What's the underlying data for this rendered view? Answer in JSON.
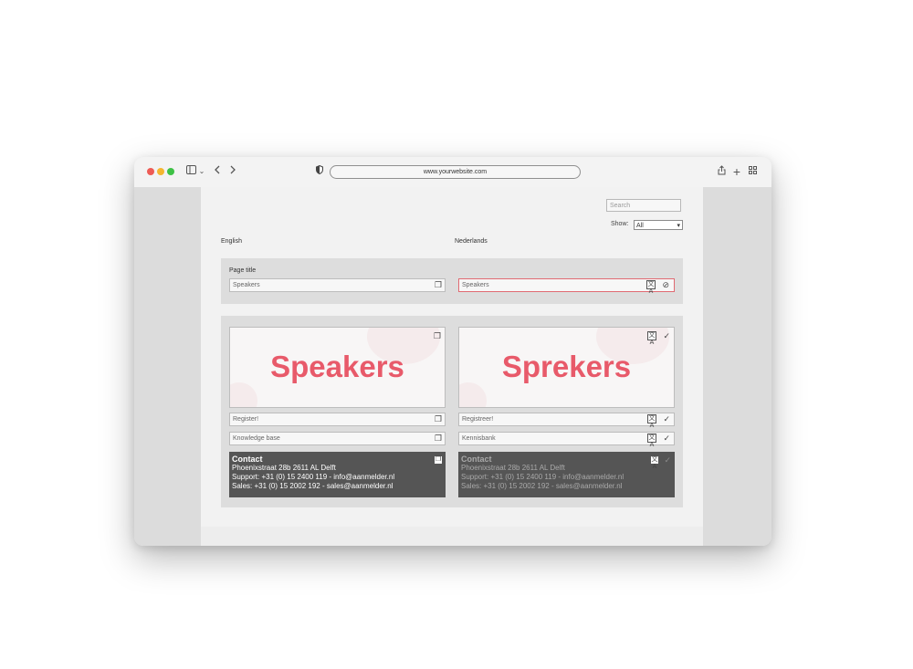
{
  "browser": {
    "url": "www.yourwebsite.com"
  },
  "page": {
    "search_placeholder": "Search",
    "show_label": "Show:",
    "show_value": "All",
    "col_source": "English",
    "col_target": "Nederlands",
    "page_title_label": "Page title",
    "page_title_source": "Speakers",
    "page_title_target": "Speakers",
    "banner_source": "Speakers",
    "banner_target": "Sprekers",
    "register_source": "Register!",
    "register_target": "Registreer!",
    "kb_source": "Knowledge base",
    "kb_target": "Kennisbank",
    "contact_source": {
      "title": "Contact",
      "line1": "Phoenixstraat 28b 2611 AL Delft",
      "line2": "Support: +31 (0) 15 2400 119 - info@aanmelder.nl",
      "line3": "Sales: +31 (0) 15 2002 192 - sales@aanmelder.nl"
    },
    "contact_target": {
      "title": "Contact",
      "line1": "Phoenixstraat 28b 2611 AL Delft",
      "line2": "Support: +31 (0) 15 2400 119 - info@aanmelder.nl",
      "line3": "Sales: +31 (0) 15 2002 192 - sales@aanmelder.nl"
    }
  },
  "colors": {
    "accent": "#e85a6a",
    "highlight_border": "#e06a72"
  }
}
